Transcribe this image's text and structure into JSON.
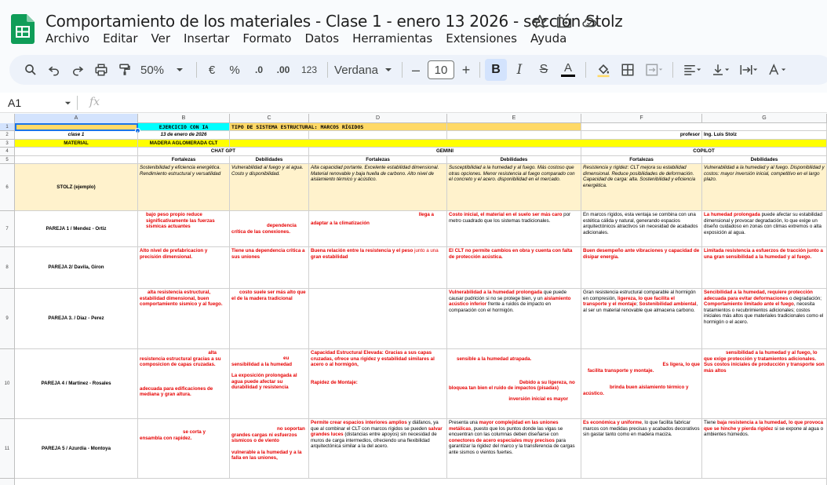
{
  "doc": {
    "title": "Comportamiento de los materiales - Clase 1 - enero 13 2026 - sección Stolz",
    "menu": [
      "Archivo",
      "Editar",
      "Ver",
      "Insertar",
      "Formato",
      "Datos",
      "Herramientas",
      "Extensiones",
      "Ayuda"
    ]
  },
  "toolbar": {
    "zoom": "50%",
    "currency": "€",
    "percent": "%",
    "dec_minus": ".0",
    "dec_plus": ".00",
    "numfmt": "123",
    "font": "Verdana",
    "font_size": "10",
    "minus": "–",
    "plus": "+",
    "bold": "B",
    "italic": "I",
    "strike": "S",
    "textcolor": "A"
  },
  "formula": {
    "namebox": "A1",
    "fx": "fx"
  },
  "colors": {
    "accent": "#1a73e8",
    "yellow": "#ffff00",
    "cream": "#fff2cc",
    "cyan": "#00ffff",
    "orange": "#ffd966",
    "red": "#e60000",
    "sheets_green": "#0f9d58"
  },
  "columns": [
    "A",
    "B",
    "C",
    "D",
    "E",
    "F",
    "G"
  ],
  "rows": [
    "1",
    "2",
    "3",
    "4",
    "5",
    "6",
    "7",
    "8",
    "9",
    "10",
    "11"
  ],
  "r1": {
    "b": "EJERCICIO CON IA",
    "c": "TIPO DE SISTEMA ESTRUCTURAL: MARCOS RÍGIDOS"
  },
  "r2": {
    "a": "clase 1",
    "b": "13 de enero de 2026",
    "f": "profesor",
    "g": "Ing. Luis Stolz"
  },
  "r3": {
    "a": "MATERIAL",
    "b": "MADERA AGLOMERADA CLT"
  },
  "r4": {
    "chatgpt": "CHAT GPT",
    "gemini": "GEMINI",
    "copilot": "COPILOT"
  },
  "r5": {
    "b": "Fortalezas",
    "c": "Debilidades",
    "d": "Fortalezas",
    "e": "Debilidades",
    "f": "Fortalezas",
    "g": "Debilidades"
  },
  "r6": {
    "a": "STOLZ (ejemplo)",
    "b": "Sostenibilidad y eficiencia energética. Rendimiento estructural y versatilidad",
    "c": "Vulnerabilidad al fuego y al agua. Costo y disponibilidad.",
    "d": "Alta capacidad portante. Excelente estabilidad dimensional. Material renovable y baja huella de carbono. Alto nivel de aislamiento térmico y acústico.",
    "e": "Susceptibilidad a la humedad y al fuego. Más costoso que otras opciones. Menor resistencia al fuego comparado con el concreto y el acero. disponibilidad en el mercado.",
    "f": "Resistencia y rigidez: CLT mejora su estabilidad dimensional. Reduce posibilidades de deformación. Capacidad de carga: alta. Sostenibilidad y eficiencia energética.",
    "g": "Vulnerabilidad a la humedad y al fuego. Disponibilidad y costos: mayor inversión inicial, competitivo en el largo plazo."
  },
  "r7": {
    "a": "PAREJA 1 / Mendez - Ortiz",
    "b": "bajo peso propio reduce significativamente las fuerzas sísmicas actuantes",
    "c1": "dependencia",
    "c2": "crítica de las conexiones.",
    "d1": "llega a",
    "d2": "adaptar a la climatización",
    "e_red": "Costo inicial, el material en el suelo ser más caro",
    "e_rest": " por metro cuadrado que los sistemas tradicionales.",
    "f": "En marcos rígidos, esta ventaja se combina con una estética cálida y natural, generando espacios arquitectónicos atractivos sin necesidad de acabados adicionales.",
    "g_red": "La humedad prolongada",
    "g_rest": " puede afectar su estabilidad dimensional y provocar degradación, lo que exige un diseño cuidadoso en zonas con climas extremos o alta exposición al agua."
  },
  "r8": {
    "a": "PAREJA 2/ Davila, Giron",
    "b": "Alto nivel de prefabricacion y precisión dimensional.",
    "c": "Tiene una dependencia critica a sus uniones",
    "d_red": "Buena relación entre la resistencia y el peso",
    "d_mid": " junto a una ",
    "d_red2": "gran estabilidad",
    "e": "El CLT no permite cambios en obra y cuenta con falta de protección acústica.",
    "f": "Buen desempeño ante vibraciones y capacidad de disipar energía.",
    "g": "Limitada resistencia a esfuerzos de tracción junto a una gran sensibilidad a la humedad y al fuego."
  },
  "r9": {
    "a": "PAREJA 3. / Diaz - Perez",
    "b": "alta resistencia estructural, estabilidad dimensional, buen comportamiento sismico y al fuego.",
    "c": "costo suele ser más alto que el de la madera tradicional",
    "e_red": "Vulnerabilidad a la humedad prolongada",
    "e_mid": " que puede causar pudrición si no se protege bien, y un ",
    "e_red2": "aislamiento acústico inferior",
    "e_rest": " frente a ruidos de impacto en comparación con el hormigón.",
    "f_a": "Gran resistencia estructural comparable al hormigón en compresión, ",
    "f_red": "ligereza, lo que facilita el transporte y el montaje",
    "f_b": "; ",
    "f_red2": "Sostenibilidad ambiental",
    "f_c": ", al ser un material renovable que almacena carbono.",
    "g_red": "Sencibilidad a la humedad, requiere protección adecuada para evitar deformaciones",
    "g_a": " o degradación; ",
    "g_red2": "Comportamiento limitado ante el fuego",
    "g_b": ", necesita tratamientos o recubrimientos adicionales; costos iniciales más altos que materiales tradicionales como el hormigón o el acero."
  },
  "r10": {
    "a": "PAREJA 4 / Martinez - Rosales",
    "b1": "alta",
    "b2": "resistencia estructural gracias a su composicion de capas cruzadas.",
    "b3": "adecuada para edificaciones de mediana y gran altura.",
    "c1": "eu",
    "c2": "sensibilidad a la humedad",
    "c3": "La exposición prolongada al agua puede afectar su durabilidad y resistencia",
    "d1": "Capacidad Estructural Elevada: Gracias a sus capas cruzadas, ofrece una rigidez y estabilidad similares al acero o al hormigón,",
    "d2": "Rapidez de Montaje:",
    "e1": "sensible a la humedad atrapada.",
    "e2": "Debido a su ligereza, no bloquea tan bien el ruido de impactos (pisadas)",
    "e3": "inversión inicial es mayor",
    "f1": "Es ligera, lo que",
    "f2": "facilita transporte y montaje.",
    "f3": "brinda buen aislamiento térmico y acústico.",
    "g": "sensibilidad a la humedad y al fuego, lo que exige protección y tratamientos adicionales. Sus costos iniciales de producción y transporte son más altos"
  },
  "r11": {
    "a": "PAREJA 5 / Azurdia - Montoya",
    "b": "se corta y ensambla con rapidez.",
    "c1": "no soportan grandes cargas ni esfuerzos sísmicos o de viento",
    "c2": "vulnerable a la humedad y a la falla en las uniones,",
    "d_red": "Permite crear espacios interiores amplios",
    "d_rest": " y diáfanos, ya que al combinar el CLT con marcos rígidos se pueden ",
    "d_red2": "salvar grandes luces",
    "d_rest2": " (distancias entre apoyos) sin necesidad de muros de carga intermedios, ofreciendo una flexibilidad arquitectónica similar a la del acero.",
    "e_a": "Presenta una ",
    "e_red": "mayor complejidad en las uniones metálicas",
    "e_b": ", puesto que los puntos donde las vigas se encuentran con las columnas deben diseñarse con ",
    "e_red2": "conectores de acero especiales muy precisos",
    "e_c": " para garantizar la rigidez del marco y la transferencia de cargas ante sismos o vientos fuertes.",
    "f_red": "Es económica y uniforme",
    "f_rest": ", lo que facilita fabricar marcos con medidas precisas y acabados decorativos sin gastar tanto como en madera maciza.",
    "g_a": "Tiene ",
    "g_red": "baja resistencia a la humedad, lo que provoca que se hinche y pierda rigidez",
    "g_b": " si se expone al agua o ambientes húmedos."
  }
}
